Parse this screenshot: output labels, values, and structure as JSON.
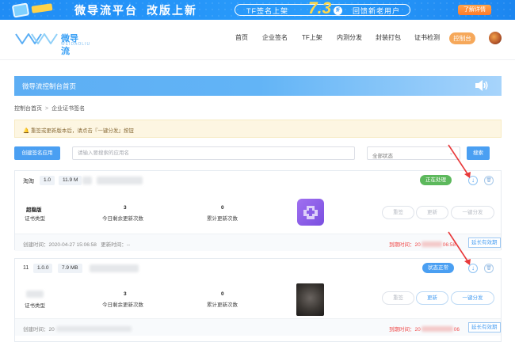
{
  "promo": {
    "title_part1": "微导流平台",
    "title_part2": "改版上新",
    "tf_text": "TF签名上架",
    "price": "7.3",
    "price_suffix": "折",
    "feedback_text": "回馈新老用户",
    "detail_button": "了解详情"
  },
  "header": {
    "logo_name": "微导流",
    "logo_sub": "WEIDAOLIU",
    "nav": [
      "首页",
      "企业签名",
      "TF上架",
      "内测分发",
      "封装打包",
      "证书检测"
    ],
    "console_button": "控制台"
  },
  "console_banner": {
    "title": "微导流控制台首页"
  },
  "breadcrumb": [
    "控制台首页",
    "企业证书签名"
  ],
  "notice": {
    "text": "重签或更新版本后，请点击『一键分发』按钮"
  },
  "toolbar": {
    "create_button": "创建签名应用",
    "search_placeholder": "请输入要搜索的应用名",
    "status_value": "全部状态",
    "search_button": "搜索"
  },
  "apps": [
    {
      "name": "淘淘",
      "version": "1.0",
      "size": "11.9 M",
      "status": "正在处理",
      "status_color": "#5cb85c",
      "cert_value": "超稳版",
      "cert_label": "证书类型",
      "remaining_value": "3",
      "remaining_label": "今日剩余更新次数",
      "total_value": "0",
      "total_label": "累计更新次数",
      "actions": [
        "重签",
        "更新",
        "一键分发"
      ],
      "created_label": "创建时间：",
      "created_value": "2020-04-27 15:06:58",
      "updated_label": "更新时间：",
      "updated_value": "--",
      "expire_label": "到期时间：",
      "expire_value": "20",
      "expire_tail": "06:58",
      "extend_button": "延长有效期"
    },
    {
      "name": "11",
      "version": "1.0.0",
      "size": "7.9 MB",
      "status": "状态正常",
      "status_color": "#4a9ff2",
      "cert_value": "",
      "cert_label": "证书类型",
      "remaining_value": "3",
      "remaining_label": "今日剩余更新次数",
      "total_value": "0",
      "total_label": "累计更新次数",
      "actions": [
        "重签",
        "更新",
        "一键分发"
      ],
      "created_label": "创建时间：",
      "created_value": "20",
      "updated_label": "",
      "updated_value": "",
      "expire_label": "到期时间：",
      "expire_value": "20",
      "expire_tail": "06",
      "extend_button": "延长有效期"
    }
  ]
}
